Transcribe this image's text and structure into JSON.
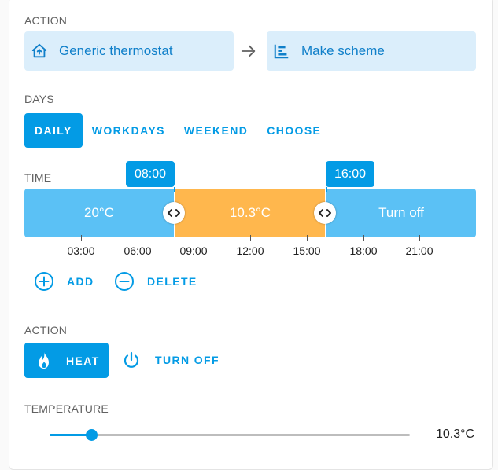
{
  "action_section": {
    "label": "ACTION",
    "entity_chip": {
      "label": "Generic thermostat",
      "icon": "home-thermostat-icon"
    },
    "arrow_icon": "arrow-right-icon",
    "scheme_chip": {
      "label": "Make scheme",
      "icon": "timeline-icon"
    }
  },
  "days_section": {
    "label": "DAYS",
    "options": [
      "DAILY",
      "WORKDAYS",
      "WEEKEND",
      "CHOOSE"
    ],
    "selected": "DAILY"
  },
  "time_section": {
    "label": "TIME",
    "segments": [
      {
        "label": "20°C",
        "color": "#5bc1f5"
      },
      {
        "label": "10.3°C",
        "color": "#ffb74d"
      },
      {
        "label": "Turn off",
        "color": "#5bc1f5"
      }
    ],
    "markers": [
      "08:00",
      "16:00"
    ],
    "ticks": [
      "03:00",
      "06:00",
      "09:00",
      "12:00",
      "15:00",
      "18:00",
      "21:00"
    ],
    "add_label": "ADD",
    "delete_label": "DELETE"
  },
  "action2_section": {
    "label": "ACTION",
    "heat_label": "HEAT",
    "heat_icon": "fire-icon",
    "turn_off_label": "TURN OFF",
    "turn_off_icon": "power-icon"
  },
  "temperature_section": {
    "label": "TEMPERATURE",
    "value": "10.3°C",
    "slider_fraction": 0.117
  },
  "colors": {
    "accent": "#039be5",
    "chip_bg": "#dbeefb",
    "cool_segment": "#5bc1f5",
    "heat_segment": "#ffb74d"
  }
}
